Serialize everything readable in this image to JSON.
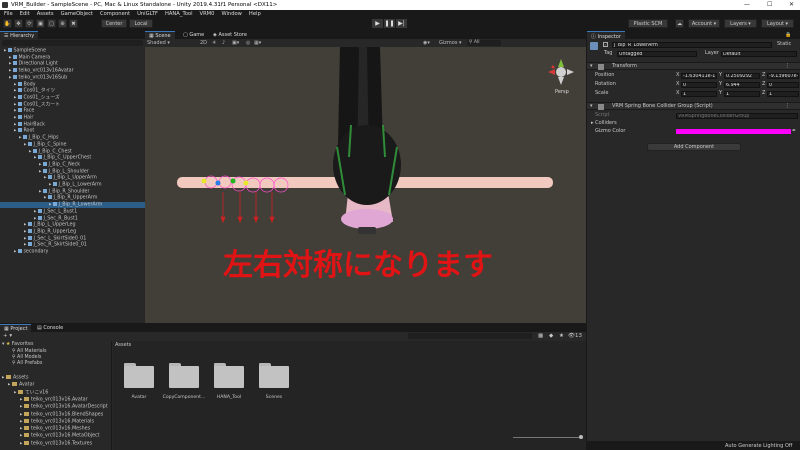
{
  "window": {
    "title": "VRM_Builder - SampleScene - PC, Mac & Linux Standalone - Unity 2019.4.31f1 Personal <DX11>"
  },
  "menu": [
    "File",
    "Edit",
    "Assets",
    "GameObject",
    "Component",
    "UniGLTF",
    "HANA_Tool",
    "VRM0",
    "Window",
    "Help"
  ],
  "toolbar": {
    "pivot": "Center",
    "space": "Local",
    "plastic": "Plastic SCM",
    "account": "Account",
    "layers": "Layers",
    "layout": "Layout"
  },
  "hierarchy": {
    "tab": "Hierarchy",
    "items": [
      {
        "label": "SampleScene",
        "depth": 0
      },
      {
        "label": "Main Camera",
        "depth": 1
      },
      {
        "label": "Directional Light",
        "depth": 1
      },
      {
        "label": "teiko_vrc013v16Avatar",
        "depth": 1
      },
      {
        "label": "teiko_vrc013v16Sub",
        "depth": 1
      },
      {
        "label": "Body",
        "depth": 2
      },
      {
        "label": "Cos01_タイツ",
        "depth": 2
      },
      {
        "label": "Cos01_シューズ",
        "depth": 2
      },
      {
        "label": "Cos01_スカート",
        "depth": 2
      },
      {
        "label": "Face",
        "depth": 2
      },
      {
        "label": "Hair",
        "depth": 2
      },
      {
        "label": "HairBack",
        "depth": 2
      },
      {
        "label": "Root",
        "depth": 2
      },
      {
        "label": "J_Bip_C_Hips",
        "depth": 3
      },
      {
        "label": "J_Bip_C_Spine",
        "depth": 4
      },
      {
        "label": "J_Bip_C_Chest",
        "depth": 5
      },
      {
        "label": "J_Bip_C_UpperChest",
        "depth": 6
      },
      {
        "label": "J_Bip_C_Neck",
        "depth": 7
      },
      {
        "label": "J_Bip_L_Shoulder",
        "depth": 7
      },
      {
        "label": "J_Bip_L_UpperArm",
        "depth": 8
      },
      {
        "label": "J_Bip_L_LowerArm",
        "depth": 9
      },
      {
        "label": "J_Bip_R_Shoulder",
        "depth": 7
      },
      {
        "label": "J_Bip_R_UpperArm",
        "depth": 8
      },
      {
        "label": "J_Bip_R_LowerArm",
        "depth": 9,
        "selected": true
      },
      {
        "label": "J_Sec_L_Bust1",
        "depth": 6
      },
      {
        "label": "J_Sec_R_Bust1",
        "depth": 6
      },
      {
        "label": "J_Bip_L_UpperLeg",
        "depth": 4
      },
      {
        "label": "J_Bip_R_UpperLeg",
        "depth": 4
      },
      {
        "label": "J_Sec_L_SkirtSide0_01",
        "depth": 4
      },
      {
        "label": "J_Sec_R_SkirtSide0_01",
        "depth": 4
      },
      {
        "label": "secondary",
        "depth": 2
      }
    ]
  },
  "scene": {
    "tabs": [
      "Scene",
      "Game",
      "Asset Store"
    ],
    "shading": "Shaded",
    "mode": "2D",
    "gizmos": "Gizmos",
    "search": "All",
    "persp": "Persp",
    "annotation": "左右対称になります"
  },
  "inspector": {
    "tab": "Inspector",
    "object": "J_Bip_R_LowerArm",
    "static": "Static",
    "tag_label": "Tag",
    "tag": "Untagged",
    "layer_label": "Layer",
    "layer": "Default",
    "transform": {
      "title": "Transform",
      "position": {
        "label": "Position",
        "x": "-1.630411e-1",
        "y": "0.2509292",
        "z": "-9.139607e-0"
      },
      "rotation": {
        "label": "Rotation",
        "x": "0",
        "y": "6.944",
        "z": "0"
      },
      "scale": {
        "label": "Scale",
        "x": "1",
        "y": "1",
        "z": "1"
      }
    },
    "component": {
      "title": "VRM Spring Bone Collider Group (Script)",
      "script_label": "Script",
      "script": "VRMSpringBoneColliderGroup",
      "colliders": "Colliders",
      "gizmo_label": "Gizmo Color",
      "gizmo_color": "#ff00ff"
    },
    "add_component": "Add Component"
  },
  "project": {
    "tabs": [
      "Project",
      "Console"
    ],
    "count": "13",
    "favorites": {
      "title": "Favorites",
      "items": [
        "All Materials",
        "All Models",
        "All Prefabs"
      ]
    },
    "tree": [
      {
        "label": "Assets",
        "depth": 0
      },
      {
        "label": "Avatar",
        "depth": 1
      },
      {
        "label": "ていこv16",
        "depth": 2
      },
      {
        "label": "teiko_vrc013v16.Avatar",
        "depth": 3
      },
      {
        "label": "teiko_vrc013v16.AvatarDescript",
        "depth": 3
      },
      {
        "label": "teiko_vrc013v16.BlendShapes",
        "depth": 3
      },
      {
        "label": "teiko_vrc013v16.Materials",
        "depth": 3
      },
      {
        "label": "teiko_vrc013v16.Meshes",
        "depth": 3
      },
      {
        "label": "teiko_vrc013v16.MetaObject",
        "depth": 3
      },
      {
        "label": "teiko_vrc013v16.Textures",
        "depth": 3
      }
    ],
    "assets_title": "Assets",
    "folders": [
      "Avatar",
      "CopyComponent...",
      "HANA_Tool",
      "Scenes"
    ]
  },
  "status": "Auto Generate Lighting Off"
}
